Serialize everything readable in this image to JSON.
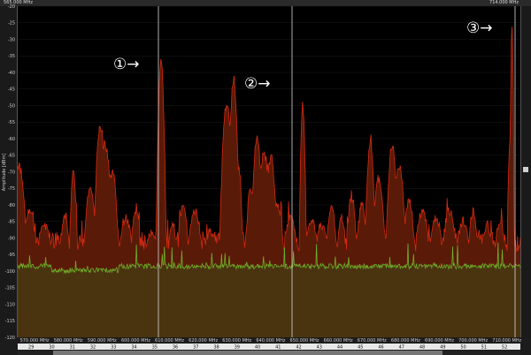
{
  "top_bar": {
    "start_freq": "565.000 MHz",
    "end_freq": "714.000 MHz"
  },
  "y_axis": {
    "title": "Amplitude [dBm]",
    "ticks": [
      "-20",
      "-25",
      "-30",
      "-35",
      "-40",
      "-45",
      "-50",
      "-55",
      "-60",
      "-65",
      "-70",
      "-75",
      "-80",
      "-85",
      "-90",
      "-95",
      "-100",
      "-105",
      "-110",
      "-115",
      "-120"
    ]
  },
  "x_axis": {
    "ticks": [
      "570.000 MHz",
      "580.000 MHz",
      "590.000 MHz",
      "600.000 MHz",
      "610.000 MHz",
      "620.000 MHz",
      "630.000 MHz",
      "640.000 MHz",
      "650.000 MHz",
      "660.000 MHz",
      "670.000 MHz",
      "680.000 MHz",
      "690.000 MHz",
      "700.000 MHz",
      "710.000 MHz"
    ]
  },
  "channels": [
    "29",
    "30",
    "31",
    "32",
    "33",
    "34",
    "35",
    "36",
    "37",
    "38",
    "39",
    "40",
    "41",
    "42",
    "43",
    "44",
    "45",
    "46",
    "47",
    "48",
    "49",
    "50",
    "51",
    "52"
  ],
  "markers": [
    {
      "label": "①→"
    },
    {
      "label": "②→"
    },
    {
      "label": "③→"
    }
  ],
  "colors": {
    "peak_trace": "#d42a10",
    "peak_fill": "#5a1a08",
    "floor_trace": "#6fb02a",
    "floor_fill": "#4a3410",
    "background": "#000000",
    "cursor": "#d8d8d8"
  }
}
